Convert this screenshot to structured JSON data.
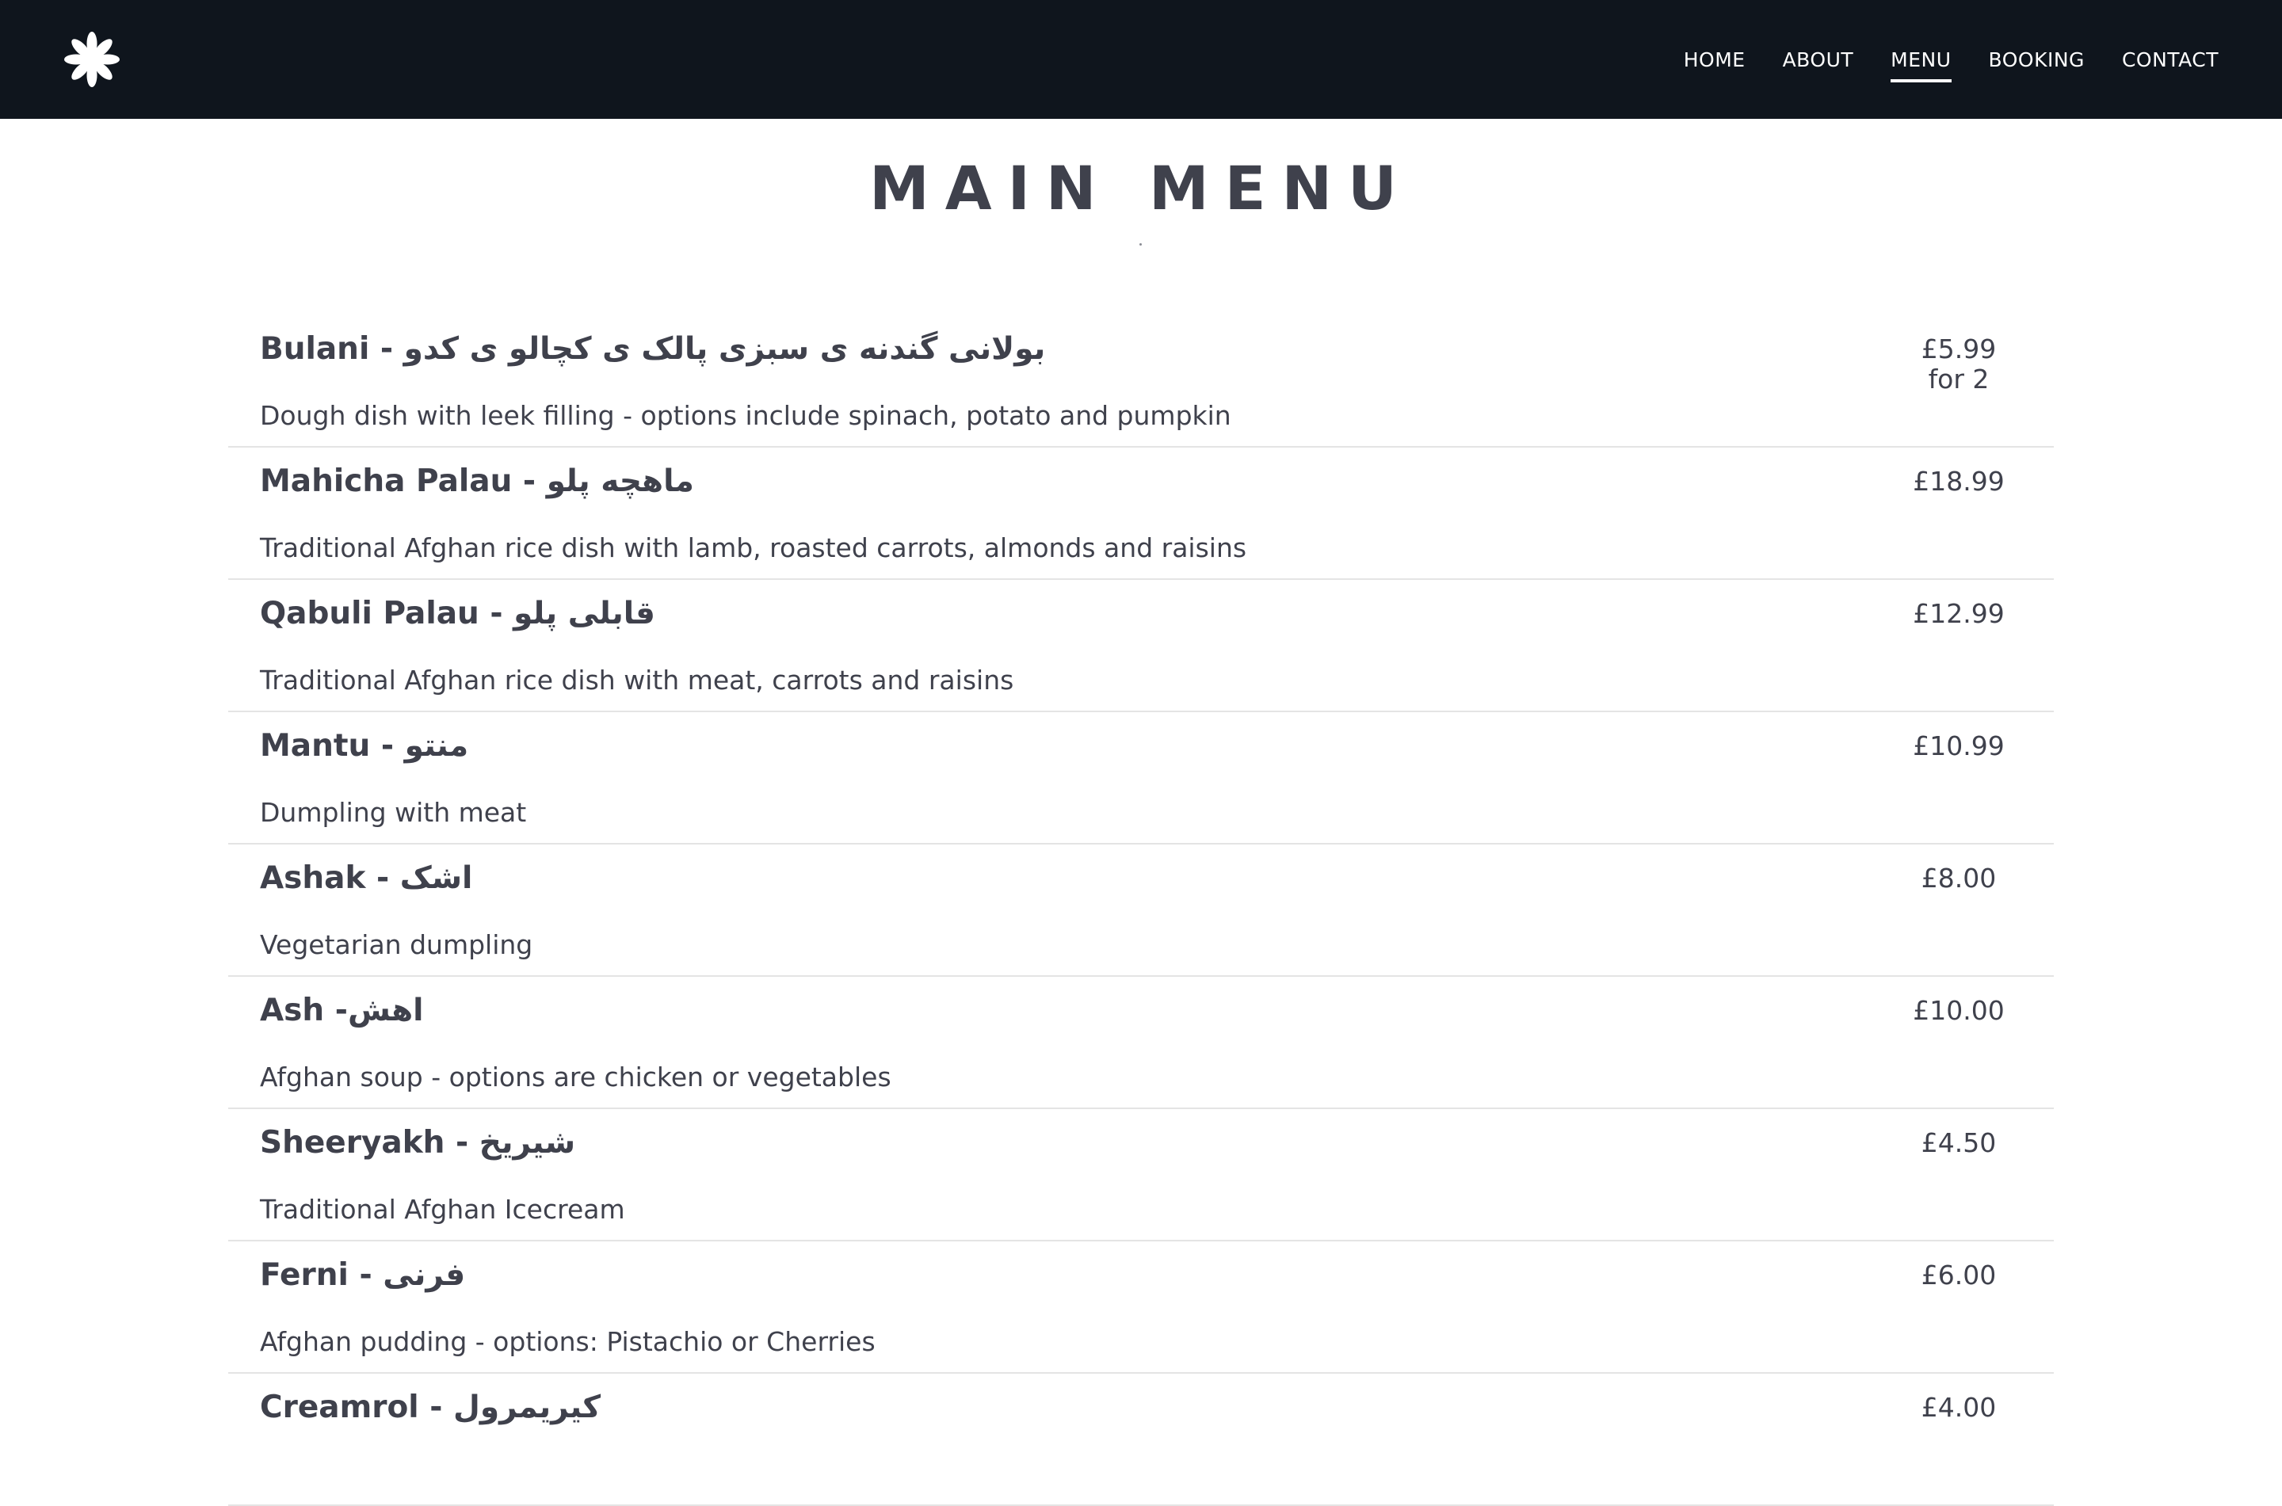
{
  "header": {
    "logo_icon": "asterisk-flower-icon",
    "nav": [
      {
        "label": "HOME",
        "active": false
      },
      {
        "label": "ABOUT",
        "active": false
      },
      {
        "label": "MENU",
        "active": true
      },
      {
        "label": "BOOKING",
        "active": false
      },
      {
        "label": "CONTACT",
        "active": false
      }
    ]
  },
  "page": {
    "title": "MAIN MENU"
  },
  "menu_items": [
    {
      "name": "Bulani - بولانی گندنه ی سبزی پالک ی کچالو ی کدو",
      "description": "Dough dish with leek filling - options include spinach, potato and pumpkin",
      "price": "£5.99",
      "price_note": "for 2"
    },
    {
      "name": "Mahicha Palau - ماهچه پلو",
      "description": "Traditional Afghan rice dish with lamb, roasted carrots, almonds and raisins",
      "price": "£18.99",
      "price_note": ""
    },
    {
      "name": "Qabuli Palau - قابلی پلو",
      "description": "Traditional Afghan rice dish with meat, carrots and raisins",
      "price": "£12.99",
      "price_note": ""
    },
    {
      "name": "Mantu - منتو",
      "description": "Dumpling with meat",
      "price": "£10.99",
      "price_note": ""
    },
    {
      "name": "Ashak - اشک",
      "description": "Vegetarian dumpling",
      "price": "£8.00",
      "price_note": ""
    },
    {
      "name": "Ash -اهش",
      "description": "Afghan soup - options are chicken or vegetables",
      "price": "£10.00",
      "price_note": ""
    },
    {
      "name": "Sheeryakh - شیریخ",
      "description": "Traditional Afghan Icecream",
      "price": "£4.50",
      "price_note": ""
    },
    {
      "name": "Ferni - فرنی",
      "description": "Afghan pudding - options: Pistachio or Cherries",
      "price": "£6.00",
      "price_note": ""
    },
    {
      "name": "Creamrol - کیریمرول",
      "description": "",
      "price": "£4.00",
      "price_note": ""
    }
  ],
  "colors": {
    "header_bg": "#0f151d",
    "text": "#3f414c",
    "divider": "#e4e4e4"
  }
}
